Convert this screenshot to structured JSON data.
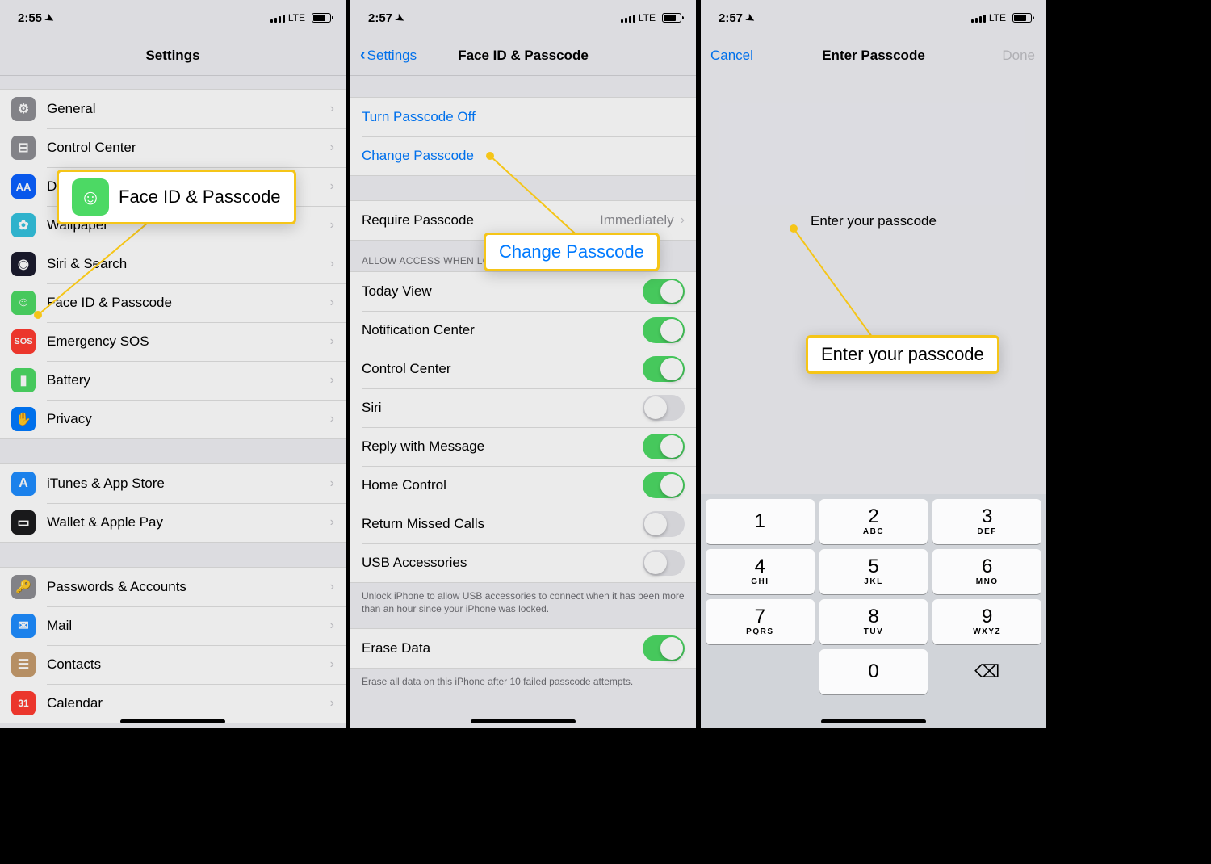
{
  "status": {
    "lte": "LTE"
  },
  "pane1": {
    "time": "2:55",
    "title": "Settings",
    "rows": {
      "general": "General",
      "control_center": "Control Center",
      "display": "D",
      "wallpaper": "Wallpaper",
      "siri_search": "Siri & Search",
      "faceid": "Face ID & Passcode",
      "sos": "Emergency SOS",
      "battery": "Battery",
      "privacy": "Privacy",
      "itunes": "iTunes & App Store",
      "wallet": "Wallet & Apple Pay",
      "passwords": "Passwords & Accounts",
      "mail": "Mail",
      "contacts": "Contacts",
      "calendar": "Calendar"
    },
    "callout": "Face ID & Passcode"
  },
  "pane2": {
    "time": "2:57",
    "back": "Settings",
    "title": "Face ID & Passcode",
    "links": {
      "turn_off": "Turn Passcode Off",
      "change": "Change Passcode"
    },
    "require": {
      "label": "Require Passcode",
      "value": "Immediately"
    },
    "allow_header": "ALLOW ACCESS WHEN LOCKED:",
    "toggles": {
      "today": "Today View",
      "nc": "Notification Center",
      "cc": "Control Center",
      "siri": "Siri",
      "reply": "Reply with Message",
      "home": "Home Control",
      "missed": "Return Missed Calls",
      "usb": "USB Accessories"
    },
    "usb_note": "Unlock iPhone to allow USB accessories to connect when it has been more than an hour since your iPhone was locked.",
    "erase": "Erase Data",
    "erase_note": "Erase all data on this iPhone after 10 failed passcode attempts.",
    "callout": "Change Passcode"
  },
  "pane3": {
    "time": "2:57",
    "cancel": "Cancel",
    "title": "Enter Passcode",
    "done": "Done",
    "prompt": "Enter your passcode",
    "callout": "Enter your passcode",
    "keypad": [
      {
        "d": "1",
        "l": ""
      },
      {
        "d": "2",
        "l": "ABC"
      },
      {
        "d": "3",
        "l": "DEF"
      },
      {
        "d": "4",
        "l": "GHI"
      },
      {
        "d": "5",
        "l": "JKL"
      },
      {
        "d": "6",
        "l": "MNO"
      },
      {
        "d": "7",
        "l": "PQRS"
      },
      {
        "d": "8",
        "l": "TUV"
      },
      {
        "d": "9",
        "l": "WXYZ"
      },
      {
        "d": "",
        "l": ""
      },
      {
        "d": "0",
        "l": ""
      },
      {
        "d": "⌫",
        "l": ""
      }
    ]
  }
}
